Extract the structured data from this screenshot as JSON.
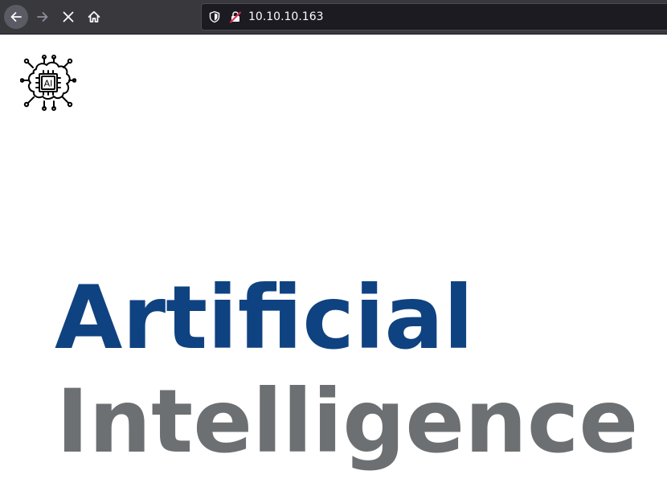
{
  "browser": {
    "url": "10.10.10.163",
    "back_icon": "arrow-left-icon",
    "forward_icon": "arrow-right-icon",
    "stop_icon": "close-icon",
    "home_icon": "home-icon",
    "tracking_icon": "shield-icon",
    "security_icon": "insecure-lock-icon"
  },
  "page": {
    "logo_icon": "ai-brain-chip-icon",
    "logo_text": "AI",
    "hero_line_1": "Artificial",
    "hero_line_2": "Intelligence"
  },
  "colors": {
    "hero_line_1": "#0f4281",
    "hero_line_2": "#6c7072",
    "toolbar": "#38383d",
    "url_bar": "#1c1b22"
  }
}
